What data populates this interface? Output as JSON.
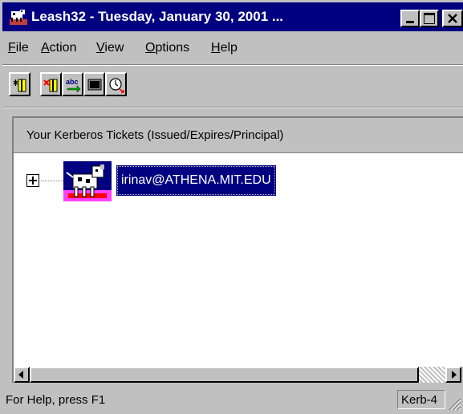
{
  "window": {
    "title": "Leash32 - Tuesday, January 30, 2001 ...",
    "icon": "leash-app-icon"
  },
  "menu": {
    "items": [
      {
        "label": "File",
        "accel": "F",
        "rest": "ile"
      },
      {
        "label": "Action",
        "accel": "A",
        "rest": "ction"
      },
      {
        "label": "View",
        "accel": "V",
        "rest": "iew"
      },
      {
        "label": "Options",
        "accel": "O",
        "rest": "ptions"
      },
      {
        "label": "Help",
        "accel": "H",
        "rest": "elp"
      }
    ]
  },
  "toolbar": {
    "buttons": [
      {
        "icon": "get-ticket-icon"
      },
      {
        "icon": "destroy-ticket-icon"
      },
      {
        "icon": "renew-ticket-icon"
      },
      {
        "icon": "debug-window-icon"
      },
      {
        "icon": "sync-time-icon"
      }
    ]
  },
  "tickets": {
    "header": "Your Kerberos Tickets (Issued/Expires/Principal)",
    "items": [
      {
        "principal": "irinav@ATHENA.MIT.EDU",
        "expanded": false,
        "selected": true,
        "icon": "kerberos-dog-icon"
      }
    ]
  },
  "statusbar": {
    "help_text": "For Help, press F1",
    "mode": "Kerb-4"
  },
  "colors": {
    "titlebar": "#000080",
    "selection": "#000080",
    "face": "#c0c0c0"
  }
}
